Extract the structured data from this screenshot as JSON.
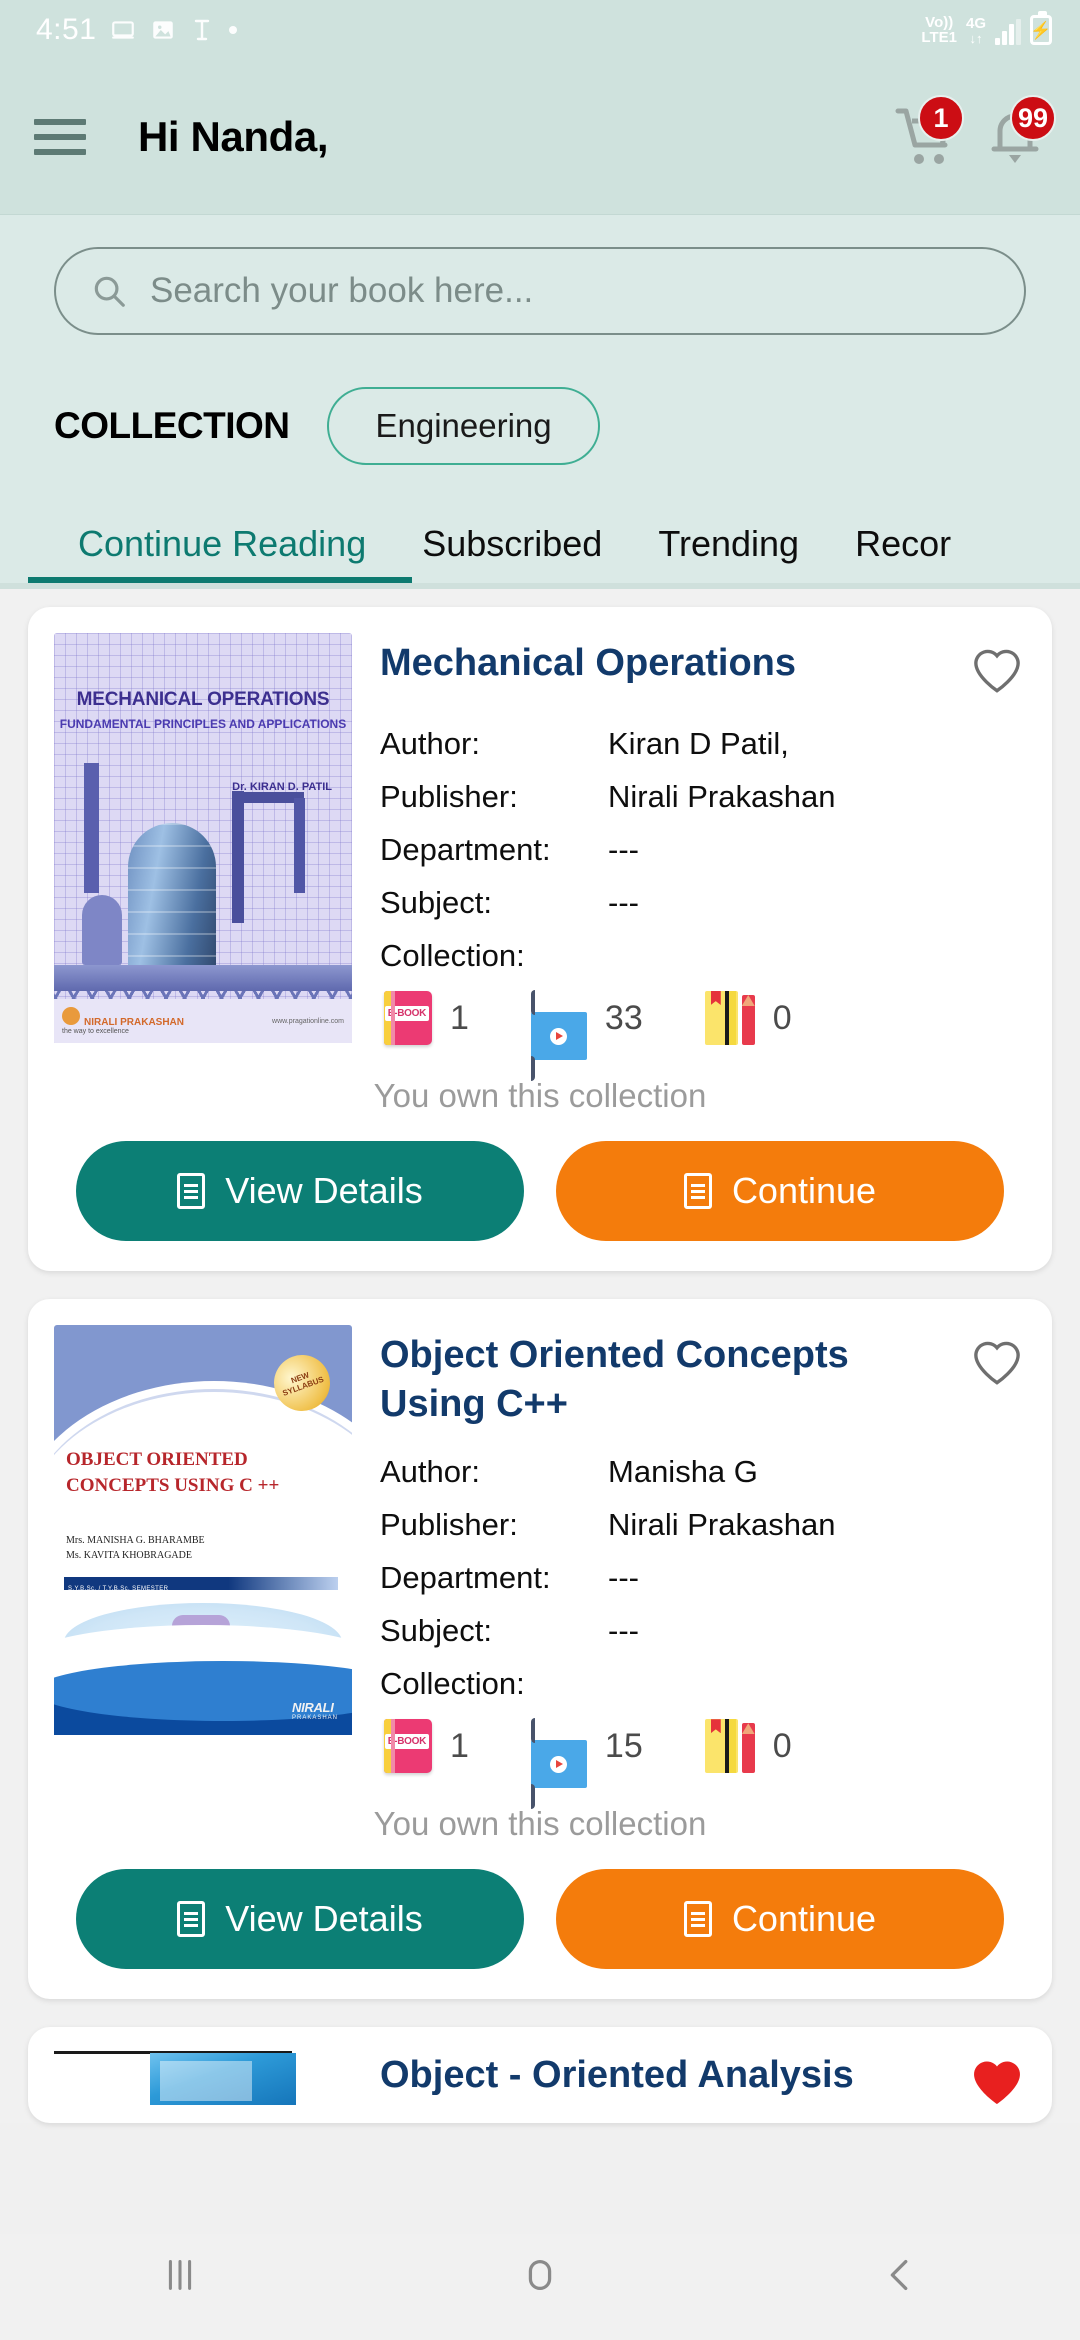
{
  "statusbar": {
    "clock": "4:51",
    "icons": [
      "tablet-icon",
      "image-icon",
      "phonepe-icon",
      "dot-icon"
    ],
    "volte": {
      "line1": "Vo))",
      "line2": "LTE1"
    },
    "network": {
      "gen": "4G",
      "arrows": "↓↑"
    },
    "battery_charging": "⚡"
  },
  "header": {
    "menu_icon": "hamburger-icon",
    "greeting": "Hi Nanda,",
    "cart": {
      "icon": "cart-icon",
      "badge": "1"
    },
    "notifications": {
      "icon": "bell-icon",
      "badge": "99"
    }
  },
  "search": {
    "icon": "search-icon",
    "placeholder": "Search your book here...",
    "value": ""
  },
  "collection": {
    "label": "COLLECTION",
    "chips": [
      {
        "label": "Engineering",
        "selected": true
      }
    ]
  },
  "tabs": [
    {
      "label": "Continue Reading",
      "active": true
    },
    {
      "label": "Subscribed",
      "active": false
    },
    {
      "label": "Trending",
      "active": false
    },
    {
      "label": "Recor",
      "active": false
    }
  ],
  "colors": {
    "header_bg": "#cfe2dd",
    "search_bg": "#dbeae7",
    "accent_teal": "#0d7a70",
    "chip_border": "#3fae93",
    "badge_red": "#cc0d14",
    "button_view": "#0c7f75",
    "button_continue": "#f47c0c",
    "title_blue": "#123a6b",
    "heart_filled": "#e8201f"
  },
  "books": [
    {
      "title": "Mechanical Operations",
      "favorite": false,
      "favorite_icon": "heart-outline-icon",
      "cover": {
        "title": "MECHANICAL OPERATIONS",
        "subtitle": "FUNDAMENTAL PRINCIPLES AND APPLICATIONS",
        "author_credit": "Dr. KIRAN D. PATIL",
        "publisher_mark": "NIRALI PRAKASHAN",
        "publisher_tagline": "the way to excellence",
        "website": "www.pragationline.com"
      },
      "meta": [
        {
          "key": "Author:",
          "value": "Kiran D Patil,"
        },
        {
          "key": "Publisher:",
          "value": "Nirali Prakashan"
        },
        {
          "key": "Department:",
          "value": "---"
        },
        {
          "key": "Subject:",
          "value": "---"
        },
        {
          "key": "Collection:",
          "value": ""
        }
      ],
      "stats": [
        {
          "icon": "ebook-icon",
          "label": "E-BOOK",
          "count": "1"
        },
        {
          "icon": "video-icon",
          "count": "33"
        },
        {
          "icon": "notes-icon",
          "count": "0"
        }
      ],
      "ownership": "You own this collection",
      "actions": [
        {
          "label": "View Details",
          "style": "teal",
          "icon": "document-icon"
        },
        {
          "label": "Continue",
          "style": "orange",
          "icon": "document-icon"
        }
      ]
    },
    {
      "title": "Object Oriented Concepts Using C++",
      "favorite": false,
      "favorite_icon": "heart-outline-icon",
      "cover": {
        "badge": "NEW SYLLABUS",
        "title_line1": "OBJECT ORIENTED",
        "title_line2": "CONCEPTS USING C ++",
        "author1": "Mrs. MANISHA G. BHARAMBE",
        "author2": "Ms. KAVITA KHOBRAGADE",
        "strip": "S.Y.B.Sc. / T.Y.B.Sc. SEMESTER",
        "publisher_mark": "NIRALI",
        "publisher_sub": "PRAKASHAN"
      },
      "meta": [
        {
          "key": "Author:",
          "value": "Manisha G"
        },
        {
          "key": "Publisher:",
          "value": "Nirali Prakashan"
        },
        {
          "key": "Department:",
          "value": "---"
        },
        {
          "key": "Subject:",
          "value": "---"
        },
        {
          "key": "Collection:",
          "value": ""
        }
      ],
      "stats": [
        {
          "icon": "ebook-icon",
          "label": "E-BOOK",
          "count": "1"
        },
        {
          "icon": "video-icon",
          "count": "15"
        },
        {
          "icon": "notes-icon",
          "count": "0"
        }
      ],
      "ownership": "You own this collection",
      "actions": [
        {
          "label": "View Details",
          "style": "teal",
          "icon": "document-icon"
        },
        {
          "label": "Continue",
          "style": "orange",
          "icon": "document-icon"
        }
      ]
    },
    {
      "title": "Object - Oriented Analysis",
      "favorite": true,
      "favorite_icon": "heart-filled-icon"
    }
  ],
  "navbar": {
    "recents": "recents-icon",
    "home": "home-icon",
    "back": "back-icon"
  }
}
